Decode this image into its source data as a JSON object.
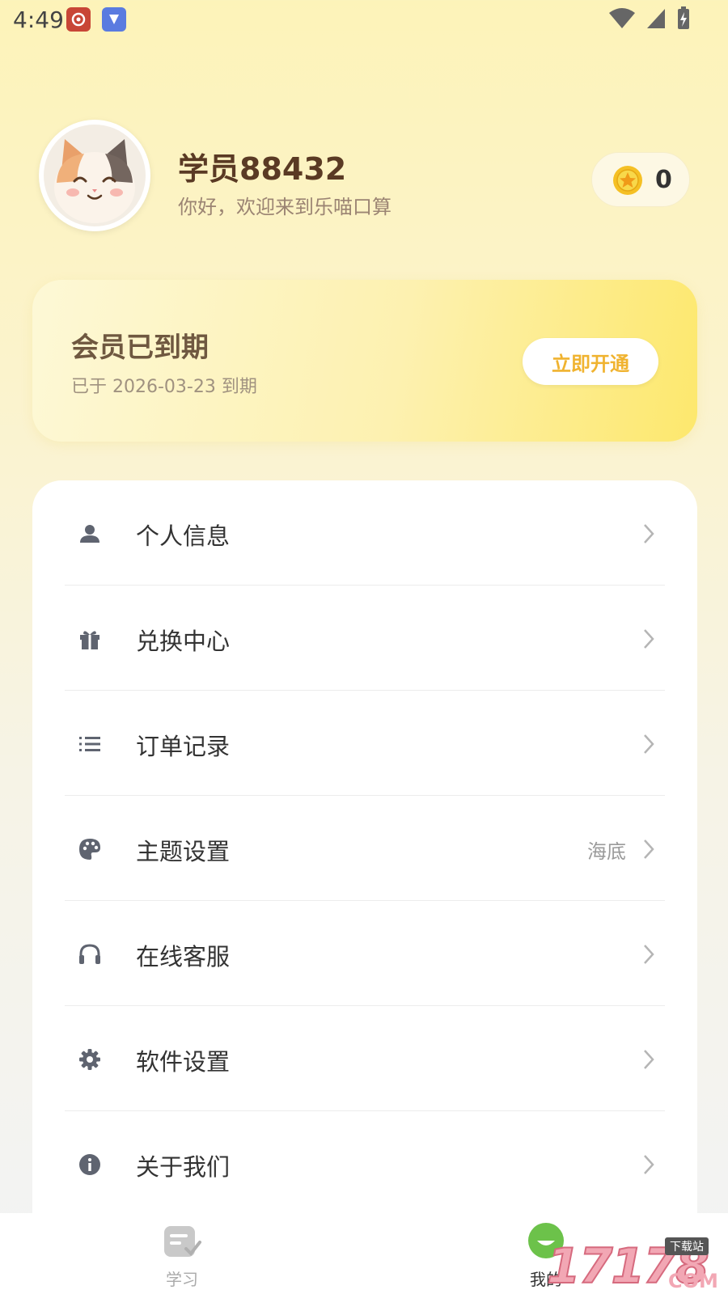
{
  "status_bar": {
    "time": "4:49"
  },
  "profile": {
    "name": "学员88432",
    "greeting": "你好，欢迎来到乐喵口算",
    "coins": "0"
  },
  "membership": {
    "title": "会员已到期",
    "expire_text": "已于 2026-03-23 到期",
    "button_label": "立即开通"
  },
  "menu": {
    "items": [
      {
        "label": "个人信息",
        "icon": "person-icon"
      },
      {
        "label": "兑换中心",
        "icon": "gift-icon"
      },
      {
        "label": "订单记录",
        "icon": "list-icon"
      },
      {
        "label": "主题设置",
        "icon": "palette-icon",
        "value": "海底"
      },
      {
        "label": "在线客服",
        "icon": "headset-icon"
      },
      {
        "label": "软件设置",
        "icon": "gear-icon"
      },
      {
        "label": "关于我们",
        "icon": "info-icon"
      }
    ]
  },
  "tabbar": {
    "tabs": [
      {
        "label": "学习",
        "icon": "study-icon",
        "active": false
      },
      {
        "label": "我的",
        "icon": "mine-icon",
        "active": true
      }
    ]
  },
  "watermark": {
    "text": "17178",
    "badge": "下载站",
    "suffix": "COM"
  },
  "colors": {
    "accent": "#f0b330",
    "active_tab": "#6cc24a",
    "brand_text": "#5a3a24"
  }
}
